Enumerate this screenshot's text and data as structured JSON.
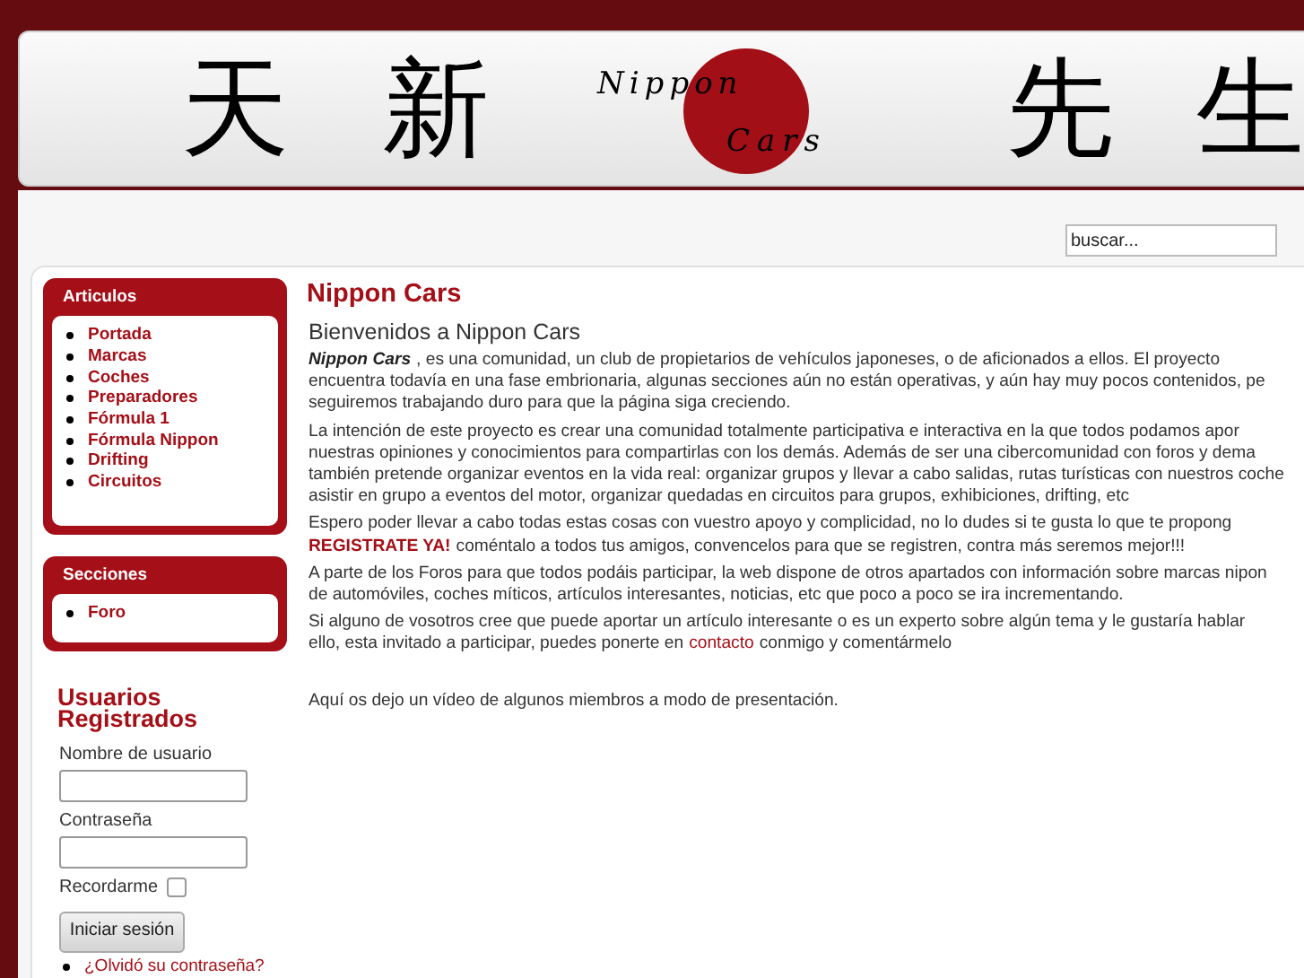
{
  "header": {
    "kanji_left": [
      "天",
      "新"
    ],
    "logo": {
      "line1": "Nippon",
      "line2": "Cars"
    },
    "kanji_right": [
      "先",
      "生"
    ]
  },
  "search": {
    "placeholder": "buscar..."
  },
  "modules": [
    {
      "title": "Articulos",
      "items": [
        "Portada",
        "Marcas",
        "Coches",
        "Preparadores",
        "Fórmula 1",
        "Fórmula Nippon",
        "Drifting",
        "Circuitos"
      ]
    },
    {
      "title": "Secciones",
      "items": [
        "Foro"
      ]
    }
  ],
  "login": {
    "title": "Usuarios Registrados",
    "username_label": "Nombre de usuario",
    "password_label": "Contraseña",
    "remember_label": "Recordarme",
    "remember_checked": false,
    "button": "Iniciar sesión",
    "links": [
      "¿Olvidó su contraseña?"
    ]
  },
  "content": {
    "title": "Nippon Cars",
    "subtitle": "Bienvenidos a Nippon Cars",
    "paragraphs": [
      {
        "lines": [
          [
            {
              "kind": "emphasis",
              "text": "Nippon Cars"
            },
            {
              "kind": "text",
              "text": ", es una comunidad, un club de propietarios de vehículos japoneses, o de aficionados a ellos. El proyecto"
            }
          ],
          [
            {
              "kind": "text",
              "text": "encuentra todavía en una fase embrionaria, algunas secciones aún no están operativas, y aún hay muy pocos contenidos, pe"
            }
          ],
          [
            {
              "kind": "text",
              "text": "seguiremos trabajando duro para que la página siga creciendo."
            }
          ]
        ]
      },
      {
        "lines": [
          [
            {
              "kind": "text",
              "text": "La intención de este proyecto es crear una comunidad totalmente participativa e interactiva en la que todos podamos apor"
            }
          ],
          [
            {
              "kind": "text",
              "text": "nuestras opiniones y conocimientos para compartirlas con los demás. Además de ser una cibercomunidad con foros y dema"
            }
          ],
          [
            {
              "kind": "text",
              "text": "también pretende organizar eventos en la vida real: organizar grupos y llevar a cabo salidas, rutas turísticas con nuestros coche"
            }
          ],
          [
            {
              "kind": "text",
              "text": "asistir en grupo a eventos del motor, organizar quedadas en circuitos para grupos, exhibiciones, drifting, etc"
            }
          ]
        ]
      },
      {
        "lines": [
          [
            {
              "kind": "text",
              "text": "Espero poder llevar a cabo todas estas cosas con vuestro apoyo y complicidad, no lo dudes si te gusta lo que te propong"
            }
          ],
          [
            {
              "kind": "highlight",
              "text": "REGISTRATE YA!"
            },
            {
              "kind": "text",
              "text": "coméntalo a todos tus amigos, convencelos para que se registren, contra más seremos mejor!!!"
            }
          ]
        ]
      },
      {
        "lines": [
          [
            {
              "kind": "text",
              "text": "A parte de los Foros para que todos podáis participar, la web dispone de otros apartados con información sobre marcas nipon"
            }
          ],
          [
            {
              "kind": "text",
              "text": "de automóviles, coches míticos, artículos interesantes, noticias, etc que poco a poco se ira incrementando."
            }
          ]
        ]
      },
      {
        "lines": [
          [
            {
              "kind": "text",
              "text": "Si alguno de vosotros cree que puede aportar un artículo interesante o es un experto sobre algún tema y le gustaría hablar"
            }
          ],
          [
            {
              "kind": "text",
              "text": "ello, esta invitado a participar, puedes ponerte en"
            },
            {
              "kind": "link",
              "text": "contacto"
            },
            {
              "kind": "text",
              "text": "conmigo y comentármelo"
            }
          ]
        ]
      },
      {
        "lines": [
          [
            {
              "kind": "text",
              "text": "Aquí os dejo un vídeo de algunos miembros a modo de presentación."
            }
          ]
        ]
      }
    ]
  }
}
